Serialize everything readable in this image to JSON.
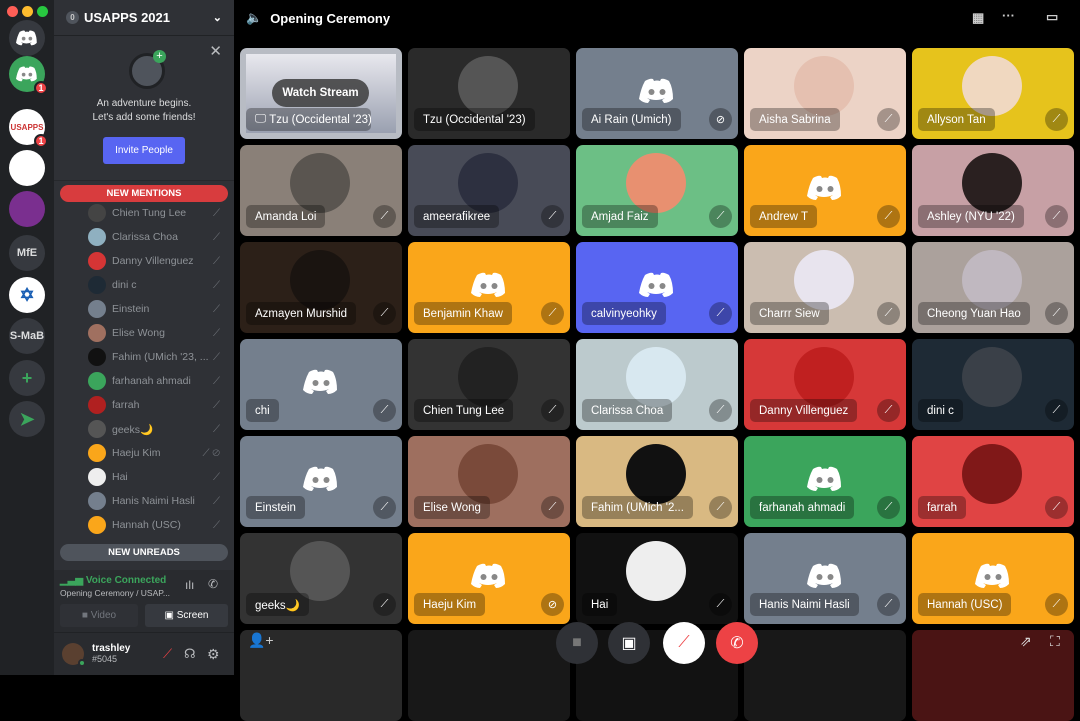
{
  "window": {
    "controls": [
      "close",
      "minimize",
      "zoom"
    ]
  },
  "servers": [
    {
      "name": "home",
      "label": "",
      "icon": "discord-logo",
      "bg": "#36393f"
    },
    {
      "name": "server-green",
      "label": "",
      "icon": "discord-logo",
      "bg": "#3ba55c",
      "badge": "1"
    },
    {
      "name": "usapps",
      "label": "USAPPS",
      "bg": "#ffffff",
      "badge": "1",
      "voice": true
    },
    {
      "name": "arch",
      "label": "",
      "icon": "arch",
      "bg": "#ffffff"
    },
    {
      "name": "house",
      "label": "",
      "icon": "house",
      "bg": "#7a2f8f"
    },
    {
      "name": "mfe",
      "label": "MfE",
      "bg": "#36393f"
    },
    {
      "name": "israel",
      "label": "✡",
      "bg": "#ffffff"
    },
    {
      "name": "s-mab",
      "label": "S-MaB",
      "bg": "#36393f"
    },
    {
      "name": "add-server",
      "label": "+",
      "bg": "#36393f"
    },
    {
      "name": "explore",
      "label": "➤",
      "bg": "#36393f"
    }
  ],
  "guild": {
    "boost": "0",
    "name": "USAPPS 2021"
  },
  "invite": {
    "line1": "An adventure begins.",
    "line2": "Let's add some friends!",
    "button": "Invite People"
  },
  "banners": {
    "mentions": "NEW MENTIONS",
    "unreads": "NEW UNREADS"
  },
  "members": [
    {
      "name": "Chien Tung Lee",
      "color": "#444"
    },
    {
      "name": "Clarissa Choa",
      "color": "#8fb0c0"
    },
    {
      "name": "Danny Villenguez",
      "color": "#d53535"
    },
    {
      "name": "dini c",
      "color": "#1e2a35"
    },
    {
      "name": "Einstein",
      "color": "#747f8d"
    },
    {
      "name": "Elise Wong",
      "color": "#a07060"
    },
    {
      "name": "Fahim (UMich '23, ...",
      "color": "#111"
    },
    {
      "name": "farhanah ahmadi",
      "color": "#3ba55c"
    },
    {
      "name": "farrah",
      "color": "#b02020"
    },
    {
      "name": "geeks🌙",
      "color": "#555"
    },
    {
      "name": "Haeju Kim",
      "color": "#faa61a",
      "deaf": true
    },
    {
      "name": "Hai",
      "color": "#eee"
    },
    {
      "name": "Hanis Naimi Hasli",
      "color": "#747f8d"
    },
    {
      "name": "Hannah (USC)",
      "color": "#faa61a"
    }
  ],
  "voice": {
    "status": "Voice Connected",
    "channel": "Opening Ceremony / USAP...",
    "video": "Video",
    "screen": "Screen"
  },
  "user": {
    "name": "trashley",
    "tag": "#5045"
  },
  "header": {
    "channel": "Opening Ceremony"
  },
  "stream": {
    "watch": "Watch Stream",
    "streamer": "Tzu (Occidental '23)"
  },
  "tiles": [
    {
      "name": "Tzu (Occidental '23)",
      "bg": "#2a2a2a",
      "av": "#555",
      "status": "none"
    },
    {
      "name": "Ai Rain (Umich)",
      "bg": "#747f8d",
      "logo": true,
      "status": "deafened"
    },
    {
      "name": "Aisha Sabrina",
      "bg": "#ecd3c6",
      "av": "#e5c0b0",
      "status": "muted"
    },
    {
      "name": "Allyson Tan",
      "bg": "#e6c31c",
      "av": "#f0d8c0",
      "status": "muted"
    },
    {
      "name": "Amanda Loi",
      "bg": "#8a8078",
      "av": "#5a5550",
      "status": "muted"
    },
    {
      "name": "ameerafikree",
      "bg": "#484b57",
      "av": "#2d3040",
      "status": "muted"
    },
    {
      "name": "Amjad Faiz",
      "bg": "#6cbf85",
      "av": "#e89070",
      "status": "muted"
    },
    {
      "name": "Andrew T",
      "bg": "#faa61a",
      "logo": true,
      "status": "muted"
    },
    {
      "name": "Ashley (NYU '22)",
      "bg": "#c7a0a5",
      "av": "#2a2020",
      "status": "muted"
    },
    {
      "name": "Azmayen Murshid",
      "bg": "#2c2018",
      "av": "#1a1410",
      "status": "muted"
    },
    {
      "name": "Benjamin Khaw",
      "bg": "#faa61a",
      "logo": true,
      "status": "muted"
    },
    {
      "name": "calvinyeohky",
      "bg": "#5865f2",
      "logo": true,
      "status": "muted"
    },
    {
      "name": "Charrr Siew",
      "bg": "#cbbdb0",
      "av": "#e8e4ee",
      "status": "muted"
    },
    {
      "name": "Cheong Yuan Hao",
      "bg": "#aba19c",
      "av": "#c0b8c0",
      "status": "muted"
    },
    {
      "name": "chi",
      "bg": "#747f8d",
      "logo": true,
      "status": "muted"
    },
    {
      "name": "Chien Tung Lee",
      "bg": "#333333",
      "av": "#222",
      "status": "muted"
    },
    {
      "name": "Clarissa Choa",
      "bg": "#bccacd",
      "av": "#d8e8f0",
      "status": "muted"
    },
    {
      "name": "Danny Villenguez",
      "bg": "#d63838",
      "av": "#c02020",
      "status": "muted"
    },
    {
      "name": "dini c",
      "bg": "#1e2a35",
      "av": "#3a4048",
      "status": "muted"
    },
    {
      "name": "Einstein",
      "bg": "#747f8d",
      "logo": true,
      "status": "muted"
    },
    {
      "name": "Elise Wong",
      "bg": "#9e6f5f",
      "av": "#7a4a3a",
      "status": "muted"
    },
    {
      "name": "Fahim (UMich '2...",
      "bg": "#d9b982",
      "av": "#111",
      "status": "muted"
    },
    {
      "name": "farhanah ahmadi",
      "bg": "#3ba55c",
      "logo": true,
      "status": "muted"
    },
    {
      "name": "farrah",
      "bg": "#e04444",
      "av": "#801818",
      "status": "muted"
    },
    {
      "name": "geeks🌙",
      "bg": "#333333",
      "av": "#555",
      "status": "muted"
    },
    {
      "name": "Haeju Kim",
      "bg": "#faa61a",
      "logo": true,
      "status": "deafened"
    },
    {
      "name": "Hai",
      "bg": "#111111",
      "av": "#eee",
      "status": "muted"
    },
    {
      "name": "Hanis Naimi Hasli",
      "bg": "#747f8d",
      "logo": true,
      "status": "muted"
    },
    {
      "name": "Hannah (USC)",
      "bg": "#faa61a",
      "logo": true,
      "status": "muted"
    }
  ]
}
